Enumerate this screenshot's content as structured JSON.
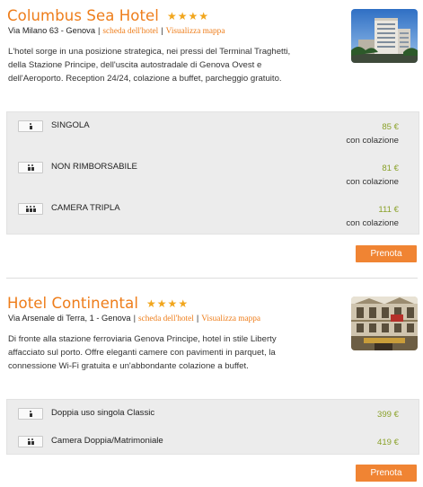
{
  "hotels": [
    {
      "name": "Columbus Sea Hotel",
      "stars": [
        "★",
        "★",
        "★",
        "★"
      ],
      "address": "Via Milano 63 - Genova",
      "details_link": "scheda dell'hotel",
      "map_link": "Visualizza mappa",
      "link_separator": "|",
      "description": "L'hotel sorge in una posizione strategica, nei pressi del Terminal Traghetti, della Stazione Principe, dell'uscita autostradale di Genova Ovest e dell'Aeroporto. Reception 24/24, colazione a buffet, parcheggio gratuito.",
      "thumbnail": "modern-hotel-building-photo",
      "rooms": [
        {
          "name": "SINGOLA",
          "guests": 1,
          "price": "85 €",
          "meal": "con colazione"
        },
        {
          "name": "NON RIMBORSABILE",
          "guests": 2,
          "price": "81 €",
          "meal": "con colazione"
        },
        {
          "name": "CAMERA TRIPLA",
          "guests": 3,
          "price": "111 €",
          "meal": "con colazione"
        }
      ],
      "book_label": "Prenota"
    },
    {
      "name": "Hotel Continental",
      "stars": [
        "★",
        "★",
        "★",
        "★"
      ],
      "address": "Via Arsenale di Terra, 1 - Genova",
      "details_link": "scheda dell'hotel",
      "map_link": "Visualizza mappa",
      "link_separator": "|",
      "description": "Di fronte alla stazione ferroviaria Genova Principe, hotel in stile Liberty affacciato sul porto. Offre eleganti camere con pavimenti in parquet, la connessione Wi-Fi gratuita e un'abbondante colazione a buffet.",
      "thumbnail": "liberty-style-hotel-facade-photo",
      "rooms": [
        {
          "name": "Doppia uso singola Classic",
          "guests": 1,
          "price": "399 €"
        },
        {
          "name": "Camera Doppia/Matrimoniale",
          "guests": 2,
          "price": "419 €"
        }
      ],
      "book_label": "Prenota"
    }
  ],
  "colors": {
    "accent": "#ee7d1a",
    "star": "#f1a61d",
    "price": "#8ba22b",
    "button": "#f08433",
    "room_panel": "#ececec"
  }
}
